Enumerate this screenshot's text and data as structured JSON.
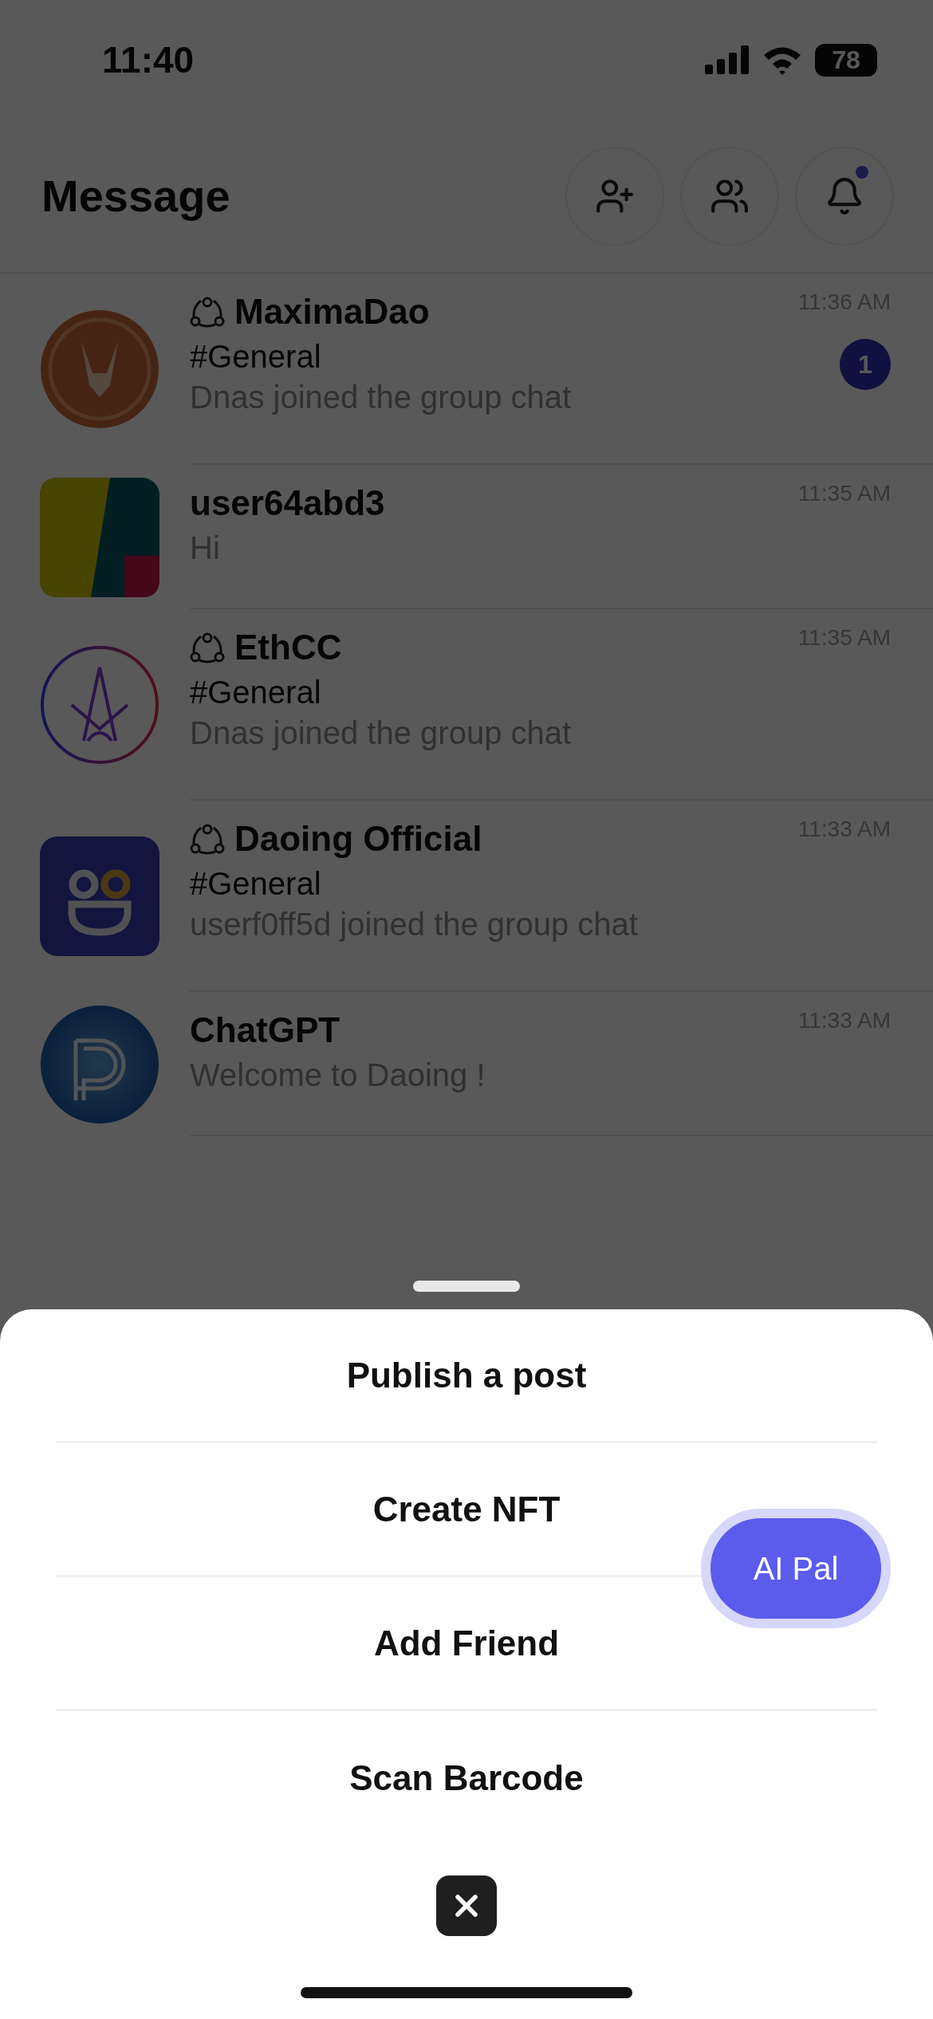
{
  "status_bar": {
    "time": "11:40",
    "battery": "78"
  },
  "header": {
    "title": "Message",
    "notifications_unread": true
  },
  "chats": [
    {
      "kind": "group",
      "name": "MaximaDao",
      "channel": "#General",
      "preview": "Dnas joined the group chat",
      "time": "11:36 AM",
      "unread": "1"
    },
    {
      "kind": "direct",
      "name": "user64abd3",
      "preview": "Hi",
      "time": "11:35 AM"
    },
    {
      "kind": "group",
      "name": "EthCC",
      "channel": "#General",
      "preview": "Dnas joined the group chat",
      "time": "11:35 AM"
    },
    {
      "kind": "group",
      "name": "Daoing Official",
      "channel": "#General",
      "preview": "userf0ff5d joined the group chat",
      "time": "11:33 AM"
    },
    {
      "kind": "direct",
      "name": "ChatGPT",
      "preview": "Welcome to Daoing !",
      "time": "11:33 AM"
    }
  ],
  "sheet": {
    "actions": [
      "Publish a post",
      "Create NFT",
      "Add Friend",
      "Scan Barcode"
    ],
    "ai_button": "AI Pal"
  }
}
